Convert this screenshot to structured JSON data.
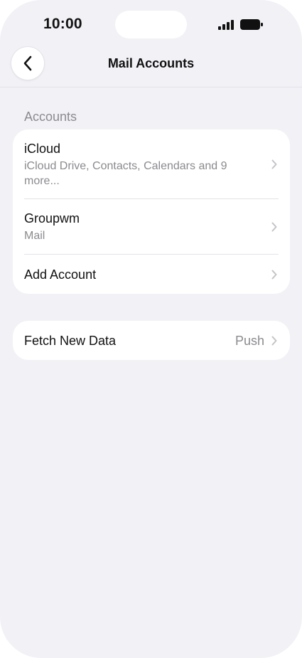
{
  "status_bar": {
    "time": "10:00"
  },
  "nav": {
    "title": "Mail Accounts",
    "back_icon": "chevron-left-icon"
  },
  "accounts_section": {
    "header": "Accounts",
    "items": [
      {
        "title": "iCloud",
        "subtitle": "iCloud Drive, Contacts, Calendars and 9 more..."
      },
      {
        "title": "Groupwm",
        "subtitle": "Mail"
      },
      {
        "title": "Add Account"
      }
    ]
  },
  "fetch": {
    "title": "Fetch New Data",
    "value": "Push"
  },
  "colors": {
    "background": "#f2f1f6",
    "card": "#ffffff",
    "secondary_text": "#8b8b90",
    "chevron": "#c4c4c7"
  }
}
